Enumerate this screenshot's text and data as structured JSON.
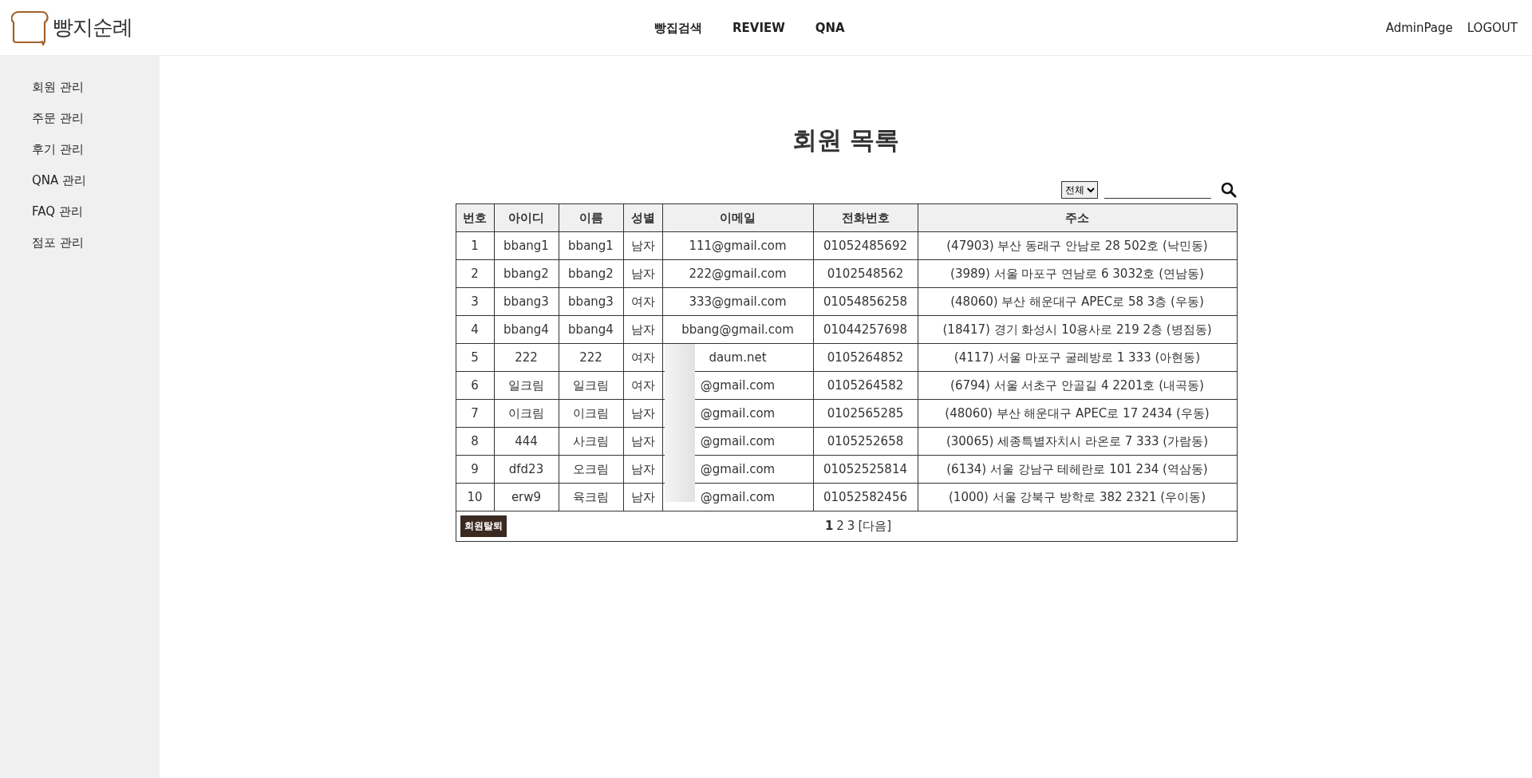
{
  "header": {
    "logo_text": "빵지순례",
    "nav": [
      "빵집검색",
      "REVIEW",
      "QNA"
    ],
    "user_links": [
      "AdminPage",
      "LOGOUT"
    ]
  },
  "sidebar": {
    "items": [
      "회원 관리",
      "주문 관리",
      "후기 관리",
      "QNA 관리",
      "FAQ 관리",
      "점포 관리"
    ]
  },
  "main": {
    "title": "회원 목록",
    "search": {
      "filter": "전체"
    },
    "table": {
      "columns": [
        "번호",
        "아이디",
        "이름",
        "성별",
        "이메일",
        "전화번호",
        "주소"
      ],
      "rows": [
        [
          "1",
          "bbang1",
          "bbang1",
          "남자",
          "111@gmail.com",
          "01052485692",
          "(47903) 부산 동래구 안남로 28 502호 (낙민동)"
        ],
        [
          "2",
          "bbang2",
          "bbang2",
          "남자",
          "222@gmail.com",
          "0102548562",
          "(3989) 서울 마포구 연남로 6 3032호 (연남동)"
        ],
        [
          "3",
          "bbang3",
          "bbang3",
          "여자",
          "333@gmail.com",
          "01054856258",
          "(48060) 부산 해운대구 APEC로 58 3층 (우동)"
        ],
        [
          "4",
          "bbang4",
          "bbang4",
          "남자",
          "bbang@gmail.com",
          "01044257698",
          "(18417) 경기 화성시 10용사로 219 2층 (병점동)"
        ],
        [
          "5",
          "222",
          "222",
          "여자",
          "daum.net",
          "0105264852",
          "(4117) 서울 마포구 굴레방로 1 333 (아현동)"
        ],
        [
          "6",
          "일크림",
          "일크림",
          "여자",
          "@gmail.com",
          "0105264582",
          "(6794) 서울 서초구 안골길 4 2201호 (내곡동)"
        ],
        [
          "7",
          "이크림",
          "이크림",
          "남자",
          "@gmail.com",
          "0102565285",
          "(48060) 부산 해운대구 APEC로 17 2434 (우동)"
        ],
        [
          "8",
          "444",
          "사크림",
          "남자",
          "@gmail.com",
          "0105252658",
          "(30065) 세종특별자치시 라온로 7 333 (가람동)"
        ],
        [
          "9",
          "dfd23",
          "오크림",
          "남자",
          "@gmail.com",
          "01052525814",
          "(6134) 서울 강남구 테헤란로 101 234 (역삼동)"
        ],
        [
          "10",
          "erw9",
          "육크림",
          "남자",
          "@gmail.com",
          "01052582456",
          "(1000) 서울 강북구 방학로 382 2321 (우이동)"
        ]
      ]
    },
    "delete_button": "회원탈퇴",
    "pagination": [
      {
        "label": "1",
        "selected": true
      },
      {
        "label": "2",
        "selected": false
      },
      {
        "label": "3",
        "selected": false
      },
      {
        "label": "[다음]",
        "selected": false
      }
    ]
  }
}
